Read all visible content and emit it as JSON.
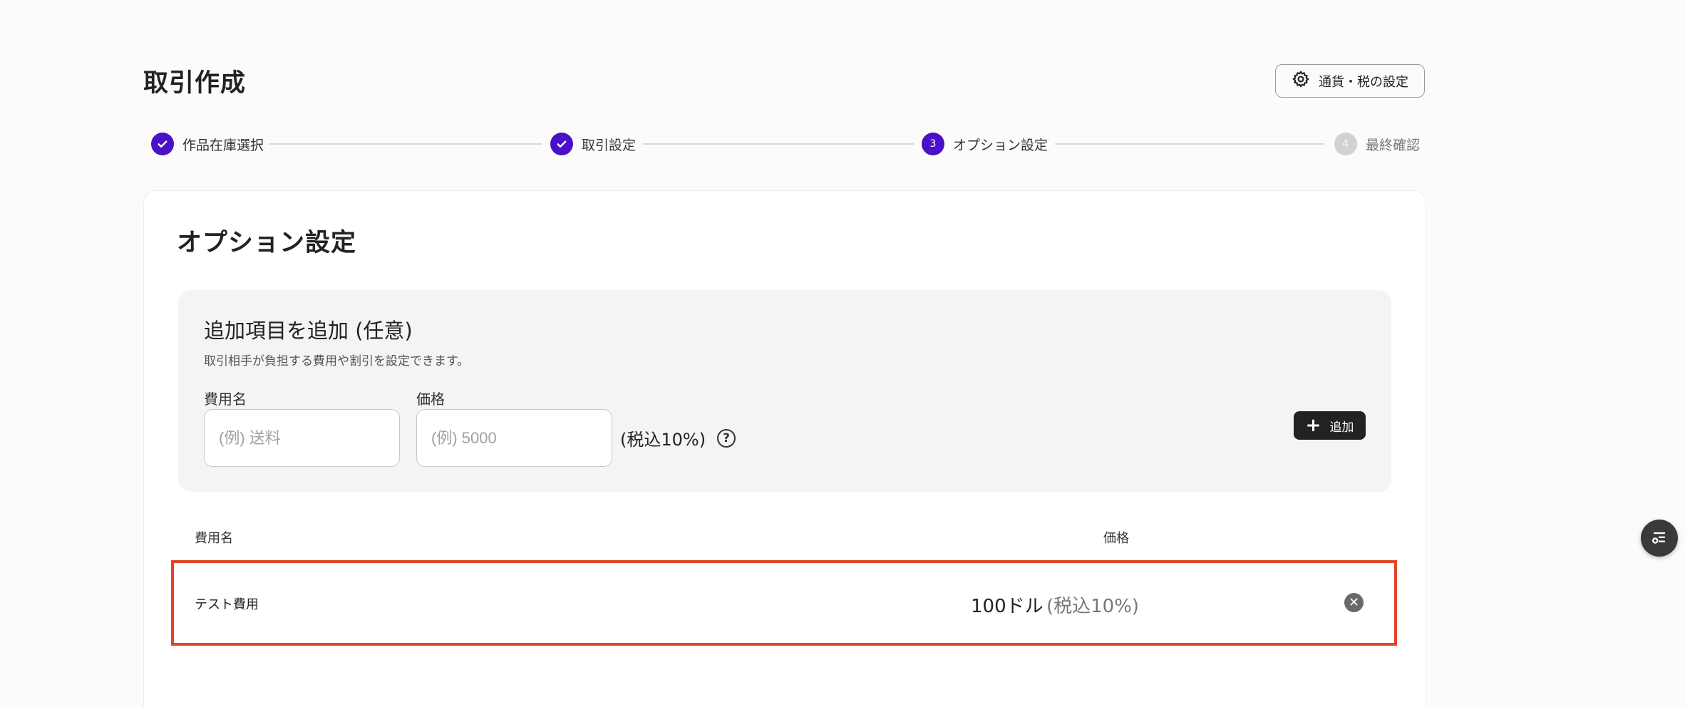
{
  "header": {
    "title": "取引作成",
    "settings_button": "通貨・税の設定"
  },
  "stepper": {
    "steps": [
      {
        "number": "1",
        "label": "作品在庫選択",
        "status": "done"
      },
      {
        "number": "2",
        "label": "取引設定",
        "status": "done"
      },
      {
        "number": "3",
        "label": "オプション設定",
        "status": "active"
      },
      {
        "number": "4",
        "label": "最終確認",
        "status": "todo"
      }
    ]
  },
  "card": {
    "title": "オプション設定",
    "panel": {
      "title": "追加項目を追加 (任意)",
      "description": "取引相手が負担する費用や割引を設定できます。",
      "name_label": "費用名",
      "name_placeholder": "(例) 送料",
      "price_label": "価格",
      "price_placeholder": "(例) 5000",
      "tax_note": "(税込10%)",
      "add_button": "追加"
    },
    "table": {
      "headers": {
        "name": "費用名",
        "price": "価格"
      },
      "rows": [
        {
          "name": "テスト費用",
          "price": "100ドル",
          "tax": "(税込10%)"
        }
      ]
    }
  },
  "colors": {
    "accent": "#4a10c8",
    "highlight": "#e3452a",
    "button_dark": "#222222"
  },
  "icons": {
    "settings": "gear-icon",
    "done": "check-icon",
    "help": "question-circle-icon",
    "add": "plus-icon",
    "remove": "close-circle-icon",
    "floating": "checklist-icon"
  }
}
